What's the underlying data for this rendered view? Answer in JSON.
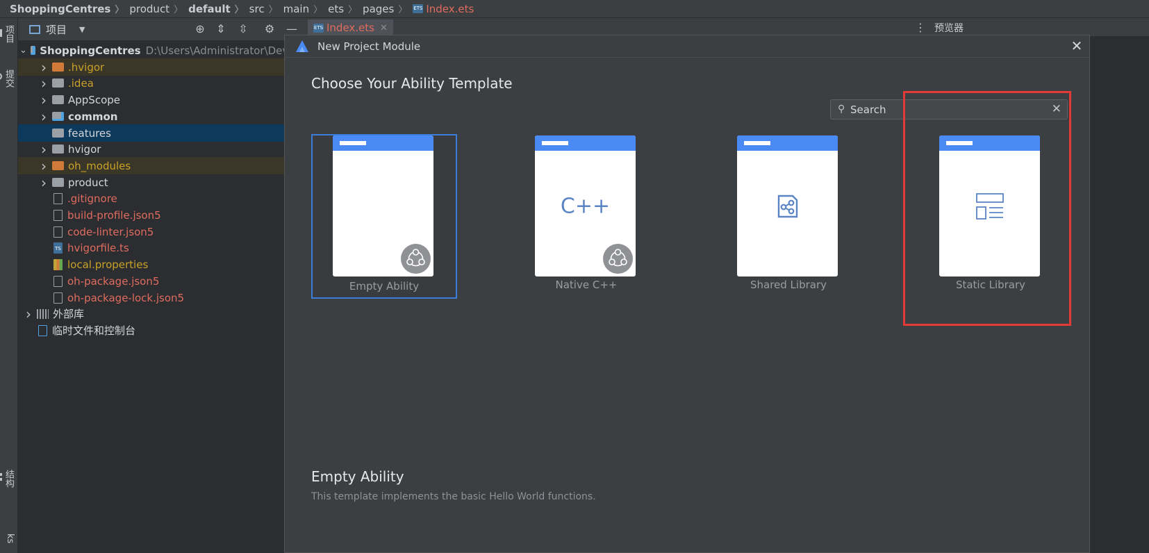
{
  "breadcrumb": [
    {
      "label": "ShoppingCentres",
      "bold": true
    },
    {
      "label": "product",
      "bold": false
    },
    {
      "label": "default",
      "bold": true
    },
    {
      "label": "src",
      "bold": false
    },
    {
      "label": "main",
      "bold": false
    },
    {
      "label": "ets",
      "bold": false
    },
    {
      "label": "pages",
      "bold": false
    }
  ],
  "breadcrumb_file": "Index.ets",
  "left_strip": {
    "project": "项目",
    "commit": "提交",
    "structure": "结构",
    "bottom": "ks"
  },
  "project_panel": {
    "title": "项目",
    "tree": [
      {
        "label": "ShoppingCentres",
        "path": "D:\\Users\\Administrator\\DevEc",
        "indent": 0,
        "chevron": "open",
        "icon": "module",
        "style": "bold",
        "row": ""
      },
      {
        "label": ".hvigor",
        "indent": 1,
        "chevron": "closed",
        "icon": "folder-orange",
        "style": "orange",
        "row": "ignored"
      },
      {
        "label": ".idea",
        "indent": 1,
        "chevron": "closed",
        "icon": "folder-gray",
        "style": "orange",
        "row": ""
      },
      {
        "label": "AppScope",
        "indent": 1,
        "chevron": "closed",
        "icon": "folder-gray",
        "style": "normal",
        "row": ""
      },
      {
        "label": "common",
        "indent": 1,
        "chevron": "closed",
        "icon": "folder-module",
        "style": "bold",
        "row": ""
      },
      {
        "label": "features",
        "indent": 1,
        "chevron": "",
        "icon": "folder-gray",
        "style": "normal",
        "row": "selected"
      },
      {
        "label": "hvigor",
        "indent": 1,
        "chevron": "closed",
        "icon": "folder-gray",
        "style": "normal",
        "row": ""
      },
      {
        "label": "oh_modules",
        "indent": 1,
        "chevron": "closed",
        "icon": "folder-orange",
        "style": "orange",
        "row": "ignored"
      },
      {
        "label": "product",
        "indent": 1,
        "chevron": "closed",
        "icon": "folder-gray",
        "style": "normal",
        "row": ""
      },
      {
        "label": ".gitignore",
        "indent": 1,
        "chevron": "",
        "icon": "file",
        "style": "red",
        "row": ""
      },
      {
        "label": "build-profile.json5",
        "indent": 1,
        "chevron": "",
        "icon": "file",
        "style": "red",
        "row": ""
      },
      {
        "label": "code-linter.json5",
        "indent": 1,
        "chevron": "",
        "icon": "file",
        "style": "red",
        "row": ""
      },
      {
        "label": "hvigorfile.ts",
        "indent": 1,
        "chevron": "",
        "icon": "file-ts",
        "style": "red",
        "row": ""
      },
      {
        "label": "local.properties",
        "indent": 1,
        "chevron": "",
        "icon": "file-props",
        "style": "orange",
        "row": ""
      },
      {
        "label": "oh-package.json5",
        "indent": 1,
        "chevron": "",
        "icon": "file",
        "style": "red",
        "row": ""
      },
      {
        "label": "oh-package-lock.json5",
        "indent": 1,
        "chevron": "",
        "icon": "file",
        "style": "red",
        "row": ""
      },
      {
        "label": "外部库",
        "indent": 0,
        "chevron": "closed",
        "icon": "library",
        "style": "normal",
        "row": ""
      },
      {
        "label": "临时文件和控制台",
        "indent": 0,
        "chevron": "",
        "icon": "scratch",
        "style": "normal",
        "row": ""
      }
    ]
  },
  "editor": {
    "tab_label": "Index.ets",
    "ets_badge": "ETS",
    "ts_badge": "TS",
    "preview_label": "预览器"
  },
  "dialog": {
    "title": "New Project Module",
    "heading": "Choose Your Ability Template",
    "search_placeholder": "Search",
    "templates": [
      {
        "label": "Empty Ability",
        "glyph": "blank",
        "badge": true,
        "selected": true
      },
      {
        "label": "Native C++",
        "glyph": "C++",
        "badge": true,
        "selected": false
      },
      {
        "label": "Shared Library",
        "glyph": "share-icon",
        "badge": false,
        "selected": false
      },
      {
        "label": "Static Library",
        "glyph": "layout-icon",
        "badge": false,
        "selected": false
      }
    ],
    "selected_title": "Empty Ability",
    "selected_description": "This template implements the basic Hello World functions."
  },
  "colors": {
    "accent": "#4a8af4",
    "selection": "#3b7dd8",
    "highlight": "#e53935"
  }
}
